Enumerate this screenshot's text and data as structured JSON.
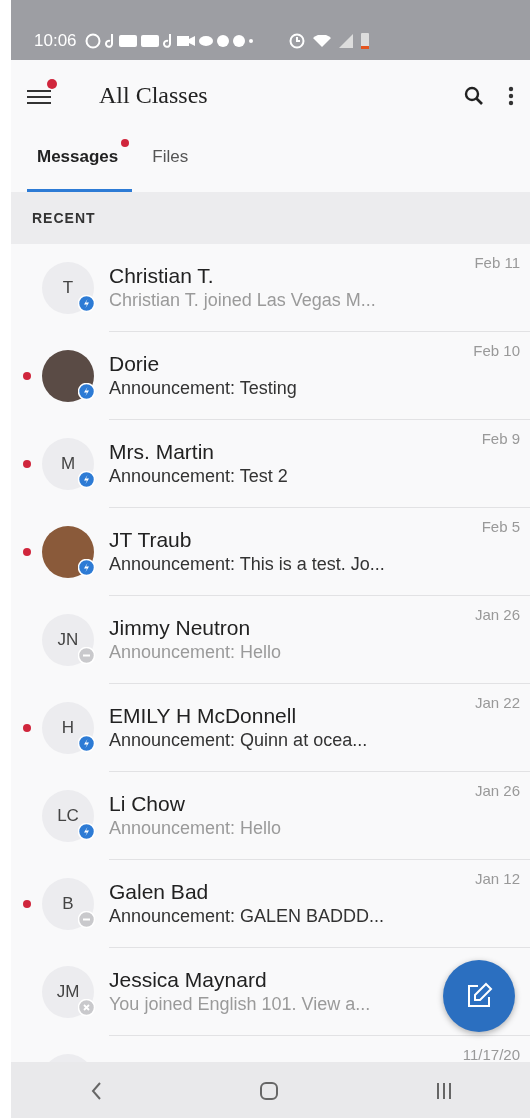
{
  "status_bar": {
    "time": "10:06"
  },
  "app_bar": {
    "title": "All Classes",
    "menu_has_alert": true
  },
  "tabs": [
    {
      "label": "Messages",
      "selected": true,
      "has_alert": true
    },
    {
      "label": "Files",
      "selected": false,
      "has_alert": false
    }
  ],
  "section_header": "RECENT",
  "conversations": [
    {
      "avatar": {
        "kind": "initials",
        "initials": "T"
      },
      "badge": {
        "kind": "active"
      },
      "unread": false,
      "name": "Christian T.",
      "preview": "Christian T. joined Las Vegas M...",
      "date": "Feb 11"
    },
    {
      "avatar": {
        "kind": "photo"
      },
      "badge": {
        "kind": "active"
      },
      "unread": true,
      "name": "Dorie",
      "preview": "Announcement: Testing",
      "date": "Feb 10"
    },
    {
      "avatar": {
        "kind": "initials",
        "initials": "M"
      },
      "badge": {
        "kind": "active"
      },
      "unread": true,
      "name": "Mrs. Martin",
      "preview": "Announcement: Test 2",
      "date": "Feb 9"
    },
    {
      "avatar": {
        "kind": "photo"
      },
      "badge": {
        "kind": "active"
      },
      "unread": true,
      "name": "JT Traub",
      "preview": "Announcement: This is a test. Jo...",
      "date": "Feb 5"
    },
    {
      "avatar": {
        "kind": "initials",
        "initials": "JN"
      },
      "badge": {
        "kind": "muted"
      },
      "unread": false,
      "name": "Jimmy Neutron",
      "preview": "Announcement: Hello",
      "date": "Jan 26"
    },
    {
      "avatar": {
        "kind": "initials",
        "initials": "H"
      },
      "badge": {
        "kind": "active"
      },
      "unread": true,
      "name": "EMILY H McDonnell",
      "preview": "Announcement: Quinn at ocea...",
      "date": "Jan 22"
    },
    {
      "avatar": {
        "kind": "initials",
        "initials": "LC"
      },
      "badge": {
        "kind": "active"
      },
      "unread": false,
      "name": "Li Chow",
      "preview": "Announcement: Hello",
      "date": "Jan 26"
    },
    {
      "avatar": {
        "kind": "initials",
        "initials": "B"
      },
      "badge": {
        "kind": "muted"
      },
      "unread": true,
      "name": "Galen Bad",
      "preview": "Announcement: GALEN BADDD...",
      "date": "Jan 12"
    },
    {
      "avatar": {
        "kind": "initials",
        "initials": "JM"
      },
      "badge": {
        "kind": "removed"
      },
      "unread": false,
      "name": "Jessica Maynard",
      "preview": "You joined English 101. View a..."
    },
    {
      "avatar": {
        "kind": "initials"
      },
      "date": "11/17/20"
    }
  ]
}
